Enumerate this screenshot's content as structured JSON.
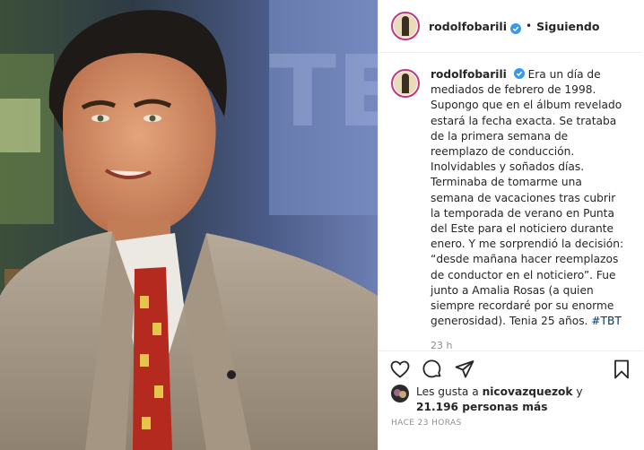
{
  "post": {
    "username": "rodolfobarili",
    "follow_status": "Siguiendo",
    "separator": "•",
    "caption_text": "Era un día de mediados de febrero de 1998. Supongo que en el álbum revelado estará la fecha exacta. Se trataba de la primera semana de reemplazo de conducción. Inolvidables y soñados días. Terminaba de tomarme una semana de vacaciones tras cubrir la temporada de verano en Punta del Este para el noticiero durante enero. Y me sorprendió la decisión: “desde mañana hacer reemplazos de conductor en el noticiero”. Fue junto a Amalia Rosas (a quien siempre recordaré por su enorme generosidad). Tenia 25 años.",
    "hashtag": "#TBT",
    "caption_time": "23 h",
    "likes_prefix": "Les gusta a",
    "likes_user": "nicovazquezok",
    "likes_connector": "y",
    "likes_count": "21.196 personas más",
    "posted_ago": "HACE 23 HORAS"
  },
  "icons": {
    "verified": "verified-badge-icon",
    "like": "heart-icon",
    "comment": "comment-icon",
    "share": "share-icon",
    "save": "bookmark-icon"
  },
  "colors": {
    "verified_blue": "#3897f0",
    "hashtag": "#00376b",
    "muted": "#8e8e8e"
  }
}
